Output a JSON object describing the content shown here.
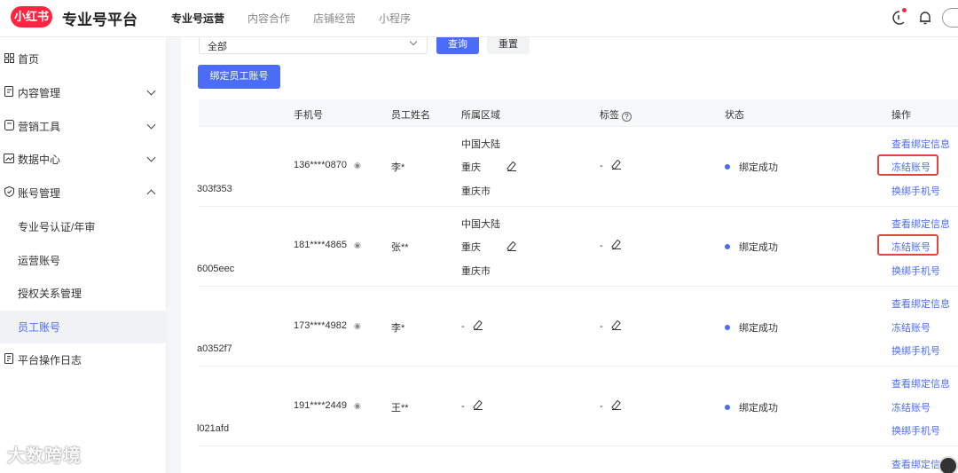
{
  "header": {
    "logo_text": "小红书",
    "platform_title": "专业号平台",
    "nav": [
      "专业号运营",
      "内容合作",
      "店铺经营",
      "小程序"
    ]
  },
  "sidebar": {
    "items": [
      {
        "label": "首页",
        "icon": "grid-icon"
      },
      {
        "label": "内容管理",
        "icon": "document-icon"
      },
      {
        "label": "营销工具",
        "icon": "tool-icon"
      },
      {
        "label": "数据中心",
        "icon": "chart-icon"
      },
      {
        "label": "账号管理",
        "icon": "account-icon"
      }
    ],
    "sub_items": [
      "专业号认证/年审",
      "运营账号",
      "授权关系管理",
      "员工账号"
    ],
    "log_item": {
      "label": "平台操作日志",
      "icon": "log-icon"
    }
  },
  "filter": {
    "select_value": "全部",
    "query_label": "查询",
    "reset_label": "重置"
  },
  "bind_button": "绑定员工账号",
  "table": {
    "headers": {
      "phone": "手机号",
      "name": "员工姓名",
      "region": "所属区域",
      "tag": "标签",
      "status": "状态",
      "actions": "操作"
    },
    "rows": [
      {
        "id": "303f353",
        "phone": "136****0870",
        "name": "李*",
        "region": [
          "中国大陆",
          "重庆",
          "重庆市"
        ],
        "tag": "-",
        "status": "绑定成功",
        "highlighted": true
      },
      {
        "id": "6005eec",
        "phone": "181****4865",
        "name": "张**",
        "region": [
          "中国大陆",
          "重庆",
          "重庆市"
        ],
        "tag": "-",
        "status": "绑定成功",
        "highlighted": true
      },
      {
        "id": "a0352f7",
        "phone": "173****4982",
        "name": "李*",
        "region": [
          "-"
        ],
        "tag": "-",
        "status": "绑定成功",
        "highlighted": false
      },
      {
        "id": "l021afd",
        "phone": "191****2449",
        "name": "王**",
        "region": [
          "-"
        ],
        "tag": "-",
        "status": "绑定成功",
        "highlighted": false
      }
    ],
    "partial_row_action": "查看绑定信",
    "actions": {
      "view": "查看绑定信息",
      "freeze": "冻结账号",
      "rebind": "换绑手机号"
    }
  },
  "watermark": "大数跨境",
  "colors": {
    "brand_red": "#ff2442",
    "accent_blue": "#4a6cf7",
    "highlight_red": "#e0463a"
  }
}
